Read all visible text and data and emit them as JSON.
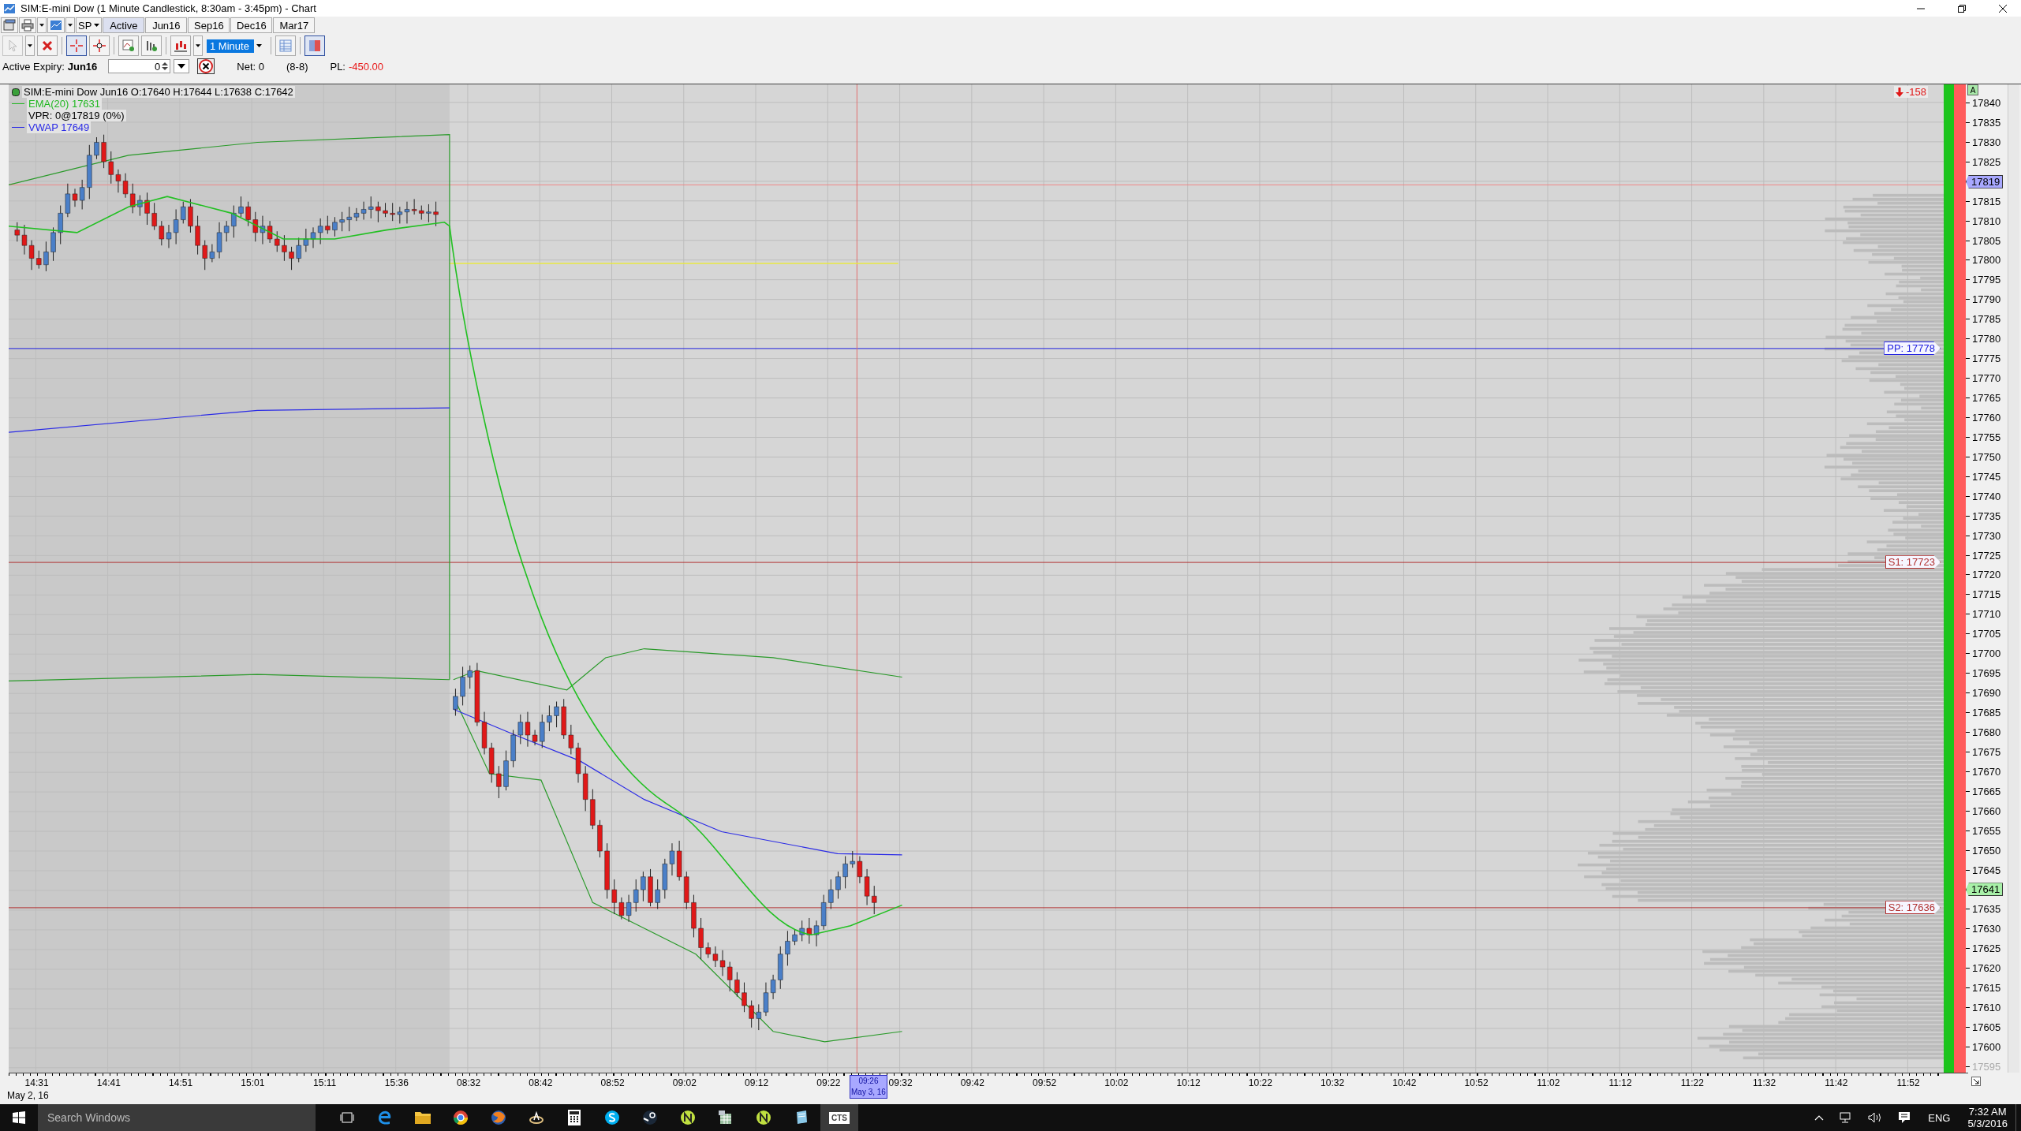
{
  "window": {
    "title": "SIM:E-mini Dow (1 Minute Candlestick, 8:30am - 3:45pm) - Chart"
  },
  "toolbar": {
    "symbol": "SP",
    "interval": "1 Minute",
    "expiry_tabs": [
      {
        "label": "Active",
        "selected": true
      },
      {
        "label": "Jun16",
        "selected": false
      },
      {
        "label": "Sep16",
        "selected": false
      },
      {
        "label": "Dec16",
        "selected": false
      },
      {
        "label": "Mar17",
        "selected": false
      }
    ]
  },
  "account_bar": {
    "expiry_label": "Active Expiry:",
    "expiry": "Jun16",
    "quantity": "0",
    "net": "Net: 0",
    "range": "(8-8)",
    "pl_label": "PL:",
    "pl": "-450.00"
  },
  "chart": {
    "legend": [
      {
        "kind": "title",
        "text": "SIM:E-mini Dow Jun16 O:17640 H:17644 L:17638 C:17642"
      },
      {
        "kind": "indicator",
        "text": "EMA(20)  17631",
        "color": "#22b822"
      },
      {
        "kind": "plain",
        "text": "VPR: 0@17819 (0%)"
      },
      {
        "kind": "indicator",
        "text": "VWAP  17649",
        "color": "#2a2ae6"
      }
    ],
    "delta": "-158",
    "auto_scale": "A",
    "levels": [
      {
        "label": "PP: 17778",
        "color": "#2020e0"
      },
      {
        "label": "S1: 17723",
        "color": "#b03030"
      },
      {
        "label": "S2: 17636",
        "color": "#b03030"
      }
    ],
    "price_axis": [
      {
        "kind": "tick",
        "label": "17840"
      },
      {
        "kind": "tick",
        "label": "17835"
      },
      {
        "kind": "tick",
        "label": "17830"
      },
      {
        "kind": "tick",
        "label": "17825"
      },
      {
        "kind": "tag",
        "label": "17819",
        "color": "#a8a8ff"
      },
      {
        "kind": "tick",
        "label": "17815"
      },
      {
        "kind": "tick",
        "label": "17810"
      },
      {
        "kind": "tick",
        "label": "17805"
      },
      {
        "kind": "tick",
        "label": "17800"
      },
      {
        "kind": "tick",
        "label": "17795"
      },
      {
        "kind": "tick",
        "label": "17790"
      },
      {
        "kind": "tick",
        "label": "17785"
      },
      {
        "kind": "tick",
        "label": "17780"
      },
      {
        "kind": "tick",
        "label": "17775"
      },
      {
        "kind": "tick",
        "label": "17770"
      },
      {
        "kind": "tick",
        "label": "17765"
      },
      {
        "kind": "tick",
        "label": "17760"
      },
      {
        "kind": "tick",
        "label": "17755"
      },
      {
        "kind": "tick",
        "label": "17750"
      },
      {
        "kind": "tick",
        "label": "17745"
      },
      {
        "kind": "tick",
        "label": "17740"
      },
      {
        "kind": "tick",
        "label": "17735"
      },
      {
        "kind": "tick",
        "label": "17730"
      },
      {
        "kind": "tick",
        "label": "17725"
      },
      {
        "kind": "tick",
        "label": "17720"
      },
      {
        "kind": "tick",
        "label": "17715"
      },
      {
        "kind": "tick",
        "label": "17710"
      },
      {
        "kind": "tick",
        "label": "17705"
      },
      {
        "kind": "tick",
        "label": "17700"
      },
      {
        "kind": "tick",
        "label": "17695"
      },
      {
        "kind": "tick",
        "label": "17690"
      },
      {
        "kind": "tick",
        "label": "17685"
      },
      {
        "kind": "tick",
        "label": "17680"
      },
      {
        "kind": "tick",
        "label": "17675"
      },
      {
        "kind": "tick",
        "label": "17670"
      },
      {
        "kind": "tick",
        "label": "17665"
      },
      {
        "kind": "tick",
        "label": "17660"
      },
      {
        "kind": "tick",
        "label": "17655"
      },
      {
        "kind": "tick",
        "label": "17650"
      },
      {
        "kind": "tick",
        "label": "17645"
      },
      {
        "kind": "tag",
        "label": "17641",
        "color": "#a8f0a8"
      },
      {
        "kind": "tick",
        "label": "17635"
      },
      {
        "kind": "tick",
        "label": "17630"
      },
      {
        "kind": "tick",
        "label": "17625"
      },
      {
        "kind": "tick",
        "label": "17620"
      },
      {
        "kind": "tick",
        "label": "17615"
      },
      {
        "kind": "tick",
        "label": "17610"
      },
      {
        "kind": "tick",
        "label": "17605"
      },
      {
        "kind": "tick",
        "label": "17600"
      },
      {
        "kind": "faint",
        "label": "17595"
      }
    ],
    "time_axis": {
      "date": "May 2, 16",
      "labels": [
        "14:31",
        "14:41",
        "14:51",
        "15:01",
        "15:11",
        "15:36",
        "08:32",
        "08:42",
        "08:52",
        "09:02",
        "09:12",
        "09:22",
        "09:32",
        "09:42",
        "09:52",
        "10:02",
        "10:12",
        "10:22",
        "10:32",
        "10:42",
        "10:52",
        "11:02",
        "11:12",
        "11:22",
        "11:32",
        "11:42",
        "11:52"
      ],
      "cursor": {
        "time": "09:26",
        "date": "May 3, 16"
      }
    }
  },
  "taskbar": {
    "search_placeholder": "Search Windows",
    "app_label": "CTS",
    "language": "ENG",
    "time": "7:32 AM",
    "date": "5/3/2016"
  }
}
